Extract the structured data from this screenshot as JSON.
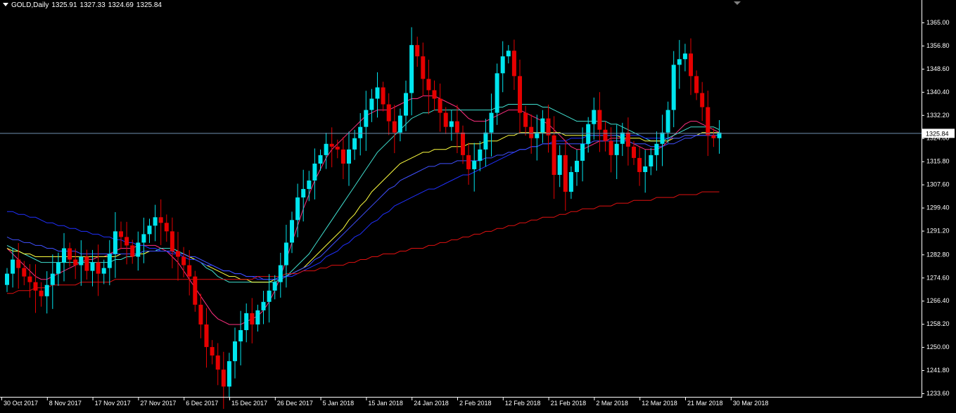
{
  "header": {
    "symbol": "GOLD,Daily",
    "open": "1325.91",
    "high": "1327.33",
    "low": "1324.69",
    "close": "1325.84"
  },
  "chart_data": {
    "type": "candlestick",
    "grid": false,
    "background": "#000000",
    "axis_color": "#ffffff",
    "bull_color": "#00e5ee",
    "bear_color": "#e60000",
    "ylim": [
      1233.6,
      1369.0
    ],
    "yticks": [
      "1365.00",
      "1356.80",
      "1348.60",
      "1340.40",
      "1332.20",
      "1324.00",
      "1315.80",
      "1307.60",
      "1299.40",
      "1291.20",
      "1282.80",
      "1274.60",
      "1266.40",
      "1258.20",
      "1250.00",
      "1241.80",
      "1233.60"
    ],
    "ytick_values": [
      1365.0,
      1356.8,
      1348.6,
      1340.4,
      1332.2,
      1324.0,
      1315.8,
      1307.6,
      1299.4,
      1291.2,
      1282.8,
      1274.6,
      1266.4,
      1258.2,
      1250.0,
      1241.8,
      1233.6
    ],
    "current_price": 1325.84,
    "current_price_label": "1325.84",
    "xtick_labels": [
      "30 Oct 2017",
      "8 Nov 2017",
      "17 Nov 2017",
      "27 Nov 2017",
      "6 Dec 2017",
      "15 Dec 2017",
      "26 Dec 2017",
      "5 Jan 2018",
      "15 Jan 2018",
      "24 Jan 2018",
      "2 Feb 2018",
      "12 Feb 2018",
      "21 Feb 2018",
      "2 Mar 2018",
      "12 Mar 2018",
      "21 Mar 2018",
      "30 Mar 2018"
    ],
    "xtick_index": [
      0,
      8,
      16,
      24,
      32,
      40,
      48,
      56,
      64,
      72,
      80,
      88,
      96,
      104,
      112,
      120,
      128
    ],
    "closes": [
      1276,
      1281,
      1278,
      1275,
      1273,
      1270,
      1268,
      1272,
      1276,
      1280,
      1285,
      1281,
      1279,
      1282,
      1277,
      1280,
      1276,
      1278,
      1283,
      1291,
      1289,
      1286,
      1282,
      1287,
      1290,
      1293,
      1296,
      1294,
      1291,
      1284,
      1282,
      1279,
      1275,
      1265,
      1258,
      1250,
      1247,
      1242,
      1236,
      1245,
      1252,
      1256,
      1262,
      1258,
      1263,
      1266,
      1270,
      1273,
      1279,
      1287,
      1295,
      1303,
      1306,
      1309,
      1315,
      1318,
      1322,
      1321,
      1320,
      1315,
      1320,
      1324,
      1328,
      1334,
      1338,
      1342,
      1336,
      1330,
      1326,
      1332,
      1340,
      1357,
      1353,
      1345,
      1341,
      1338,
      1333,
      1328,
      1330,
      1326,
      1318,
      1313,
      1316,
      1320,
      1326,
      1333,
      1347,
      1353,
      1355,
      1346,
      1333,
      1328,
      1324,
      1326,
      1331,
      1325,
      1311,
      1318,
      1305,
      1312,
      1316,
      1322,
      1329,
      1334,
      1327,
      1323,
      1318,
      1322,
      1326,
      1321,
      1317,
      1312,
      1314,
      1318,
      1322,
      1326,
      1334,
      1350,
      1352,
      1354,
      1346,
      1340,
      1335,
      1325,
      1324,
      1326
    ],
    "series": [
      {
        "name": "",
        "color": "#ff3080",
        "values": [
          1285,
          1283,
          1281,
          1279,
          1277,
          1275,
          1274,
          1274,
          1275,
          1276,
          1277,
          1278,
          1279,
          1280,
          1281,
          1281,
          1282,
          1282,
          1283,
          1284,
          1285,
          1285,
          1285,
          1286,
          1286,
          1286,
          1286,
          1285,
          1284,
          1282,
          1280,
          1277,
          1274,
          1271,
          1268,
          1265,
          1262,
          1260,
          1259,
          1258,
          1258,
          1258,
          1259,
          1260,
          1261,
          1263,
          1266,
          1270,
          1275,
          1281,
          1287,
          1293,
          1299,
          1304,
          1309,
          1313,
          1317,
          1320,
          1322,
          1324,
          1326,
          1328,
          1330,
          1332,
          1333,
          1334,
          1334,
          1334,
          1335,
          1336,
          1337,
          1338,
          1338,
          1339,
          1339,
          1339,
          1338,
          1337,
          1336,
          1335,
          1333,
          1331,
          1330,
          1330,
          1330,
          1331,
          1332,
          1333,
          1334,
          1334,
          1334,
          1333,
          1332,
          1331,
          1330,
          1329,
          1327,
          1325,
          1323,
          1321,
          1320,
          1320,
          1321,
          1322,
          1323,
          1323,
          1324,
          1324,
          1324,
          1323,
          1322,
          1321,
          1320,
          1320,
          1320,
          1321,
          1323,
          1325,
          1327,
          1329,
          1330,
          1330,
          1329,
          1328,
          1327,
          1326
        ]
      },
      {
        "name": "",
        "color": "#40e0d0",
        "values": [
          1286,
          1285,
          1284,
          1283,
          1282,
          1281,
          1280,
          1280,
          1280,
          1280,
          1280,
          1280,
          1280,
          1280,
          1280,
          1280,
          1280,
          1280,
          1280,
          1281,
          1281,
          1282,
          1282,
          1283,
          1283,
          1284,
          1284,
          1285,
          1285,
          1285,
          1284,
          1283,
          1282,
          1281,
          1280,
          1278,
          1277,
          1275,
          1274,
          1273,
          1273,
          1273,
          1273,
          1273,
          1273,
          1273,
          1273,
          1273,
          1274,
          1275,
          1277,
          1279,
          1281,
          1283,
          1286,
          1289,
          1292,
          1295,
          1298,
          1301,
          1304,
          1307,
          1310,
          1313,
          1316,
          1319,
          1321,
          1323,
          1325,
          1327,
          1329,
          1331,
          1332,
          1333,
          1333,
          1334,
          1334,
          1334,
          1334,
          1334,
          1334,
          1334,
          1334,
          1334,
          1334,
          1334,
          1335,
          1335,
          1336,
          1336,
          1336,
          1336,
          1336,
          1336,
          1335,
          1335,
          1334,
          1333,
          1332,
          1331,
          1330,
          1330,
          1330,
          1330,
          1330,
          1330,
          1329,
          1329,
          1328,
          1327,
          1326,
          1325,
          1324,
          1323,
          1323,
          1323,
          1324,
          1325,
          1326,
          1327,
          1328,
          1328,
          1328,
          1328,
          1328,
          1327
        ]
      },
      {
        "name": "",
        "color": "#ffff40",
        "values": [
          1285,
          1284,
          1284,
          1283,
          1283,
          1282,
          1282,
          1282,
          1282,
          1282,
          1282,
          1282,
          1282,
          1282,
          1282,
          1282,
          1282,
          1282,
          1282,
          1282,
          1283,
          1283,
          1283,
          1283,
          1283,
          1284,
          1284,
          1284,
          1284,
          1284,
          1283,
          1283,
          1282,
          1281,
          1280,
          1279,
          1278,
          1277,
          1276,
          1275,
          1275,
          1274,
          1274,
          1273,
          1273,
          1273,
          1273,
          1274,
          1274,
          1275,
          1276,
          1277,
          1278,
          1280,
          1282,
          1284,
          1286,
          1288,
          1290,
          1292,
          1295,
          1297,
          1300,
          1302,
          1305,
          1307,
          1309,
          1311,
          1313,
          1315,
          1316,
          1317,
          1318,
          1319,
          1319,
          1320,
          1320,
          1320,
          1321,
          1321,
          1321,
          1322,
          1322,
          1322,
          1323,
          1323,
          1323,
          1324,
          1325,
          1325,
          1326,
          1326,
          1326,
          1326,
          1326,
          1326,
          1326,
          1326,
          1325,
          1325,
          1325,
          1325,
          1325,
          1325,
          1325,
          1325,
          1325,
          1325,
          1324,
          1324,
          1324,
          1324,
          1323,
          1323,
          1323,
          1323,
          1323,
          1324,
          1324,
          1325,
          1325,
          1325,
          1326,
          1326,
          1326,
          1326
        ]
      },
      {
        "name": "",
        "color": "#2030ff",
        "values": [
          1298,
          1298,
          1297,
          1297,
          1296,
          1296,
          1295,
          1294,
          1294,
          1293,
          1293,
          1292,
          1292,
          1291,
          1291,
          1290,
          1290,
          1289,
          1289,
          1288,
          1288,
          1287,
          1287,
          1286,
          1286,
          1285,
          1285,
          1284,
          1284,
          1283,
          1283,
          1282,
          1281,
          1281,
          1280,
          1279,
          1279,
          1278,
          1277,
          1277,
          1276,
          1276,
          1275,
          1275,
          1274,
          1274,
          1274,
          1274,
          1274,
          1275,
          1275,
          1276,
          1277,
          1278,
          1279,
          1280,
          1282,
          1283,
          1284,
          1286,
          1287,
          1289,
          1290,
          1292,
          1294,
          1295,
          1297,
          1298,
          1300,
          1301,
          1302,
          1303,
          1304,
          1305,
          1306,
          1306,
          1307,
          1308,
          1309,
          1310,
          1311,
          1311,
          1312,
          1313,
          1314,
          1315,
          1316,
          1317,
          1318,
          1319,
          1320,
          1320,
          1321,
          1321,
          1322,
          1322,
          1323,
          1323,
          1323,
          1324,
          1324,
          1324,
          1325,
          1325,
          1325,
          1325,
          1325,
          1325,
          1325,
          1325,
          1325,
          1325,
          1324,
          1324,
          1324,
          1324,
          1324,
          1324,
          1324,
          1325,
          1325,
          1325,
          1325,
          1325,
          1325,
          1325
        ]
      },
      {
        "name": "",
        "color": "#4050ff",
        "values": [
          1289,
          1288,
          1288,
          1287,
          1287,
          1286,
          1286,
          1285,
          1285,
          1284,
          1284,
          1284,
          1284,
          1283,
          1283,
          1283,
          1283,
          1283,
          1283,
          1283,
          1283,
          1283,
          1283,
          1283,
          1284,
          1284,
          1284,
          1284,
          1284,
          1284,
          1283,
          1283,
          1282,
          1282,
          1281,
          1280,
          1279,
          1278,
          1277,
          1277,
          1276,
          1276,
          1275,
          1275,
          1275,
          1274,
          1274,
          1274,
          1275,
          1275,
          1276,
          1277,
          1278,
          1279,
          1281,
          1282,
          1284,
          1286,
          1288,
          1290,
          1292,
          1294,
          1296,
          1298,
          1300,
          1302,
          1304,
          1306,
          1307,
          1309,
          1310,
          1311,
          1312,
          1313,
          1314,
          1314,
          1315,
          1315,
          1315,
          1316,
          1316,
          1316,
          1316,
          1316,
          1317,
          1317,
          1318,
          1318,
          1319,
          1319,
          1320,
          1320,
          1321,
          1321,
          1322,
          1322,
          1322,
          1322,
          1322,
          1322,
          1322,
          1322,
          1322,
          1323,
          1323,
          1323,
          1323,
          1323,
          1323,
          1323,
          1322,
          1322,
          1322,
          1321,
          1321,
          1321,
          1322,
          1322,
          1323,
          1324,
          1324,
          1325,
          1325,
          1325,
          1325,
          1325
        ]
      },
      {
        "name": "",
        "color": "#e01010",
        "values": [
          1269,
          1269,
          1270,
          1270,
          1270,
          1271,
          1271,
          1271,
          1272,
          1272,
          1272,
          1272,
          1272,
          1273,
          1273,
          1273,
          1273,
          1273,
          1273,
          1274,
          1274,
          1274,
          1274,
          1274,
          1274,
          1274,
          1274,
          1274,
          1274,
          1274,
          1274,
          1274,
          1274,
          1274,
          1274,
          1274,
          1274,
          1274,
          1274,
          1274,
          1274,
          1274,
          1274,
          1274,
          1275,
          1275,
          1275,
          1275,
          1275,
          1276,
          1276,
          1276,
          1277,
          1277,
          1277,
          1278,
          1278,
          1279,
          1279,
          1279,
          1280,
          1280,
          1281,
          1281,
          1282,
          1282,
          1283,
          1283,
          1283,
          1284,
          1284,
          1285,
          1285,
          1285,
          1286,
          1286,
          1287,
          1287,
          1288,
          1288,
          1289,
          1289,
          1290,
          1290,
          1291,
          1291,
          1292,
          1292,
          1293,
          1293,
          1294,
          1294,
          1295,
          1295,
          1296,
          1296,
          1296,
          1297,
          1297,
          1298,
          1298,
          1299,
          1299,
          1299,
          1300,
          1300,
          1300,
          1301,
          1301,
          1301,
          1302,
          1302,
          1302,
          1302,
          1303,
          1303,
          1303,
          1303,
          1304,
          1304,
          1304,
          1304,
          1305,
          1305,
          1305,
          1305
        ]
      }
    ]
  }
}
